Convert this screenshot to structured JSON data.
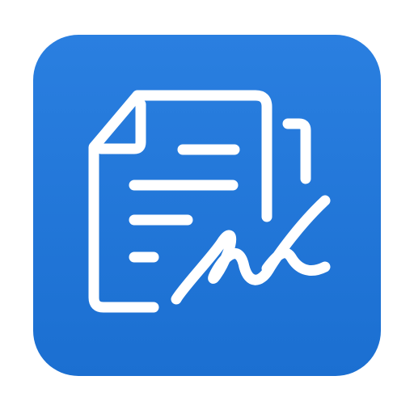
{
  "app_icon": {
    "name": "document-signature-app-icon",
    "background_color": "#1B6FD1",
    "background_highlight": "#2A7FE0",
    "glyph_color": "#ffffff",
    "icons": [
      "document-icon",
      "back-page-icon",
      "signature-icon"
    ]
  }
}
